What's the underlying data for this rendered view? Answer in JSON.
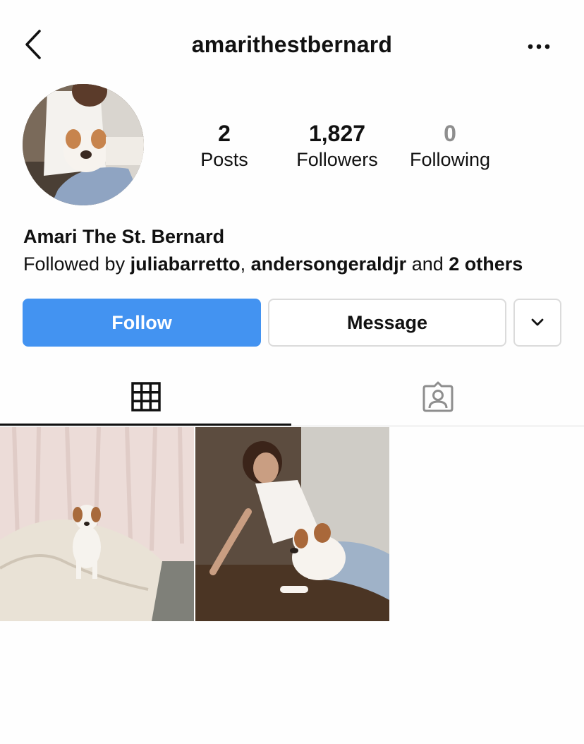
{
  "header": {
    "username": "amarithestbernard",
    "back_icon": "chevron-left-icon",
    "more_icon": "more-horizontal-icon"
  },
  "profile": {
    "avatar_alt": "avatar",
    "stats": [
      {
        "value": "2",
        "label": "Posts"
      },
      {
        "value": "1,827",
        "label": "Followers"
      },
      {
        "value": "0",
        "label": "Following"
      }
    ],
    "display_name": "Amari The St. Bernard",
    "followed_by": {
      "prefix": "Followed by ",
      "user1": "juliabarretto",
      "separator": ", ",
      "user2": "andersongeraldjr",
      "and": " and ",
      "others": "2 others"
    }
  },
  "actions": {
    "follow_label": "Follow",
    "message_label": "Message",
    "more_icon": "chevron-down-icon"
  },
  "tabs": [
    {
      "name": "grid",
      "icon": "grid-icon",
      "active": true
    },
    {
      "name": "tagged",
      "icon": "tagged-person-icon",
      "active": false
    }
  ],
  "colors": {
    "follow_button": "#4393f1",
    "border": "#dbdbdb",
    "muted": "#8e8e8e"
  }
}
